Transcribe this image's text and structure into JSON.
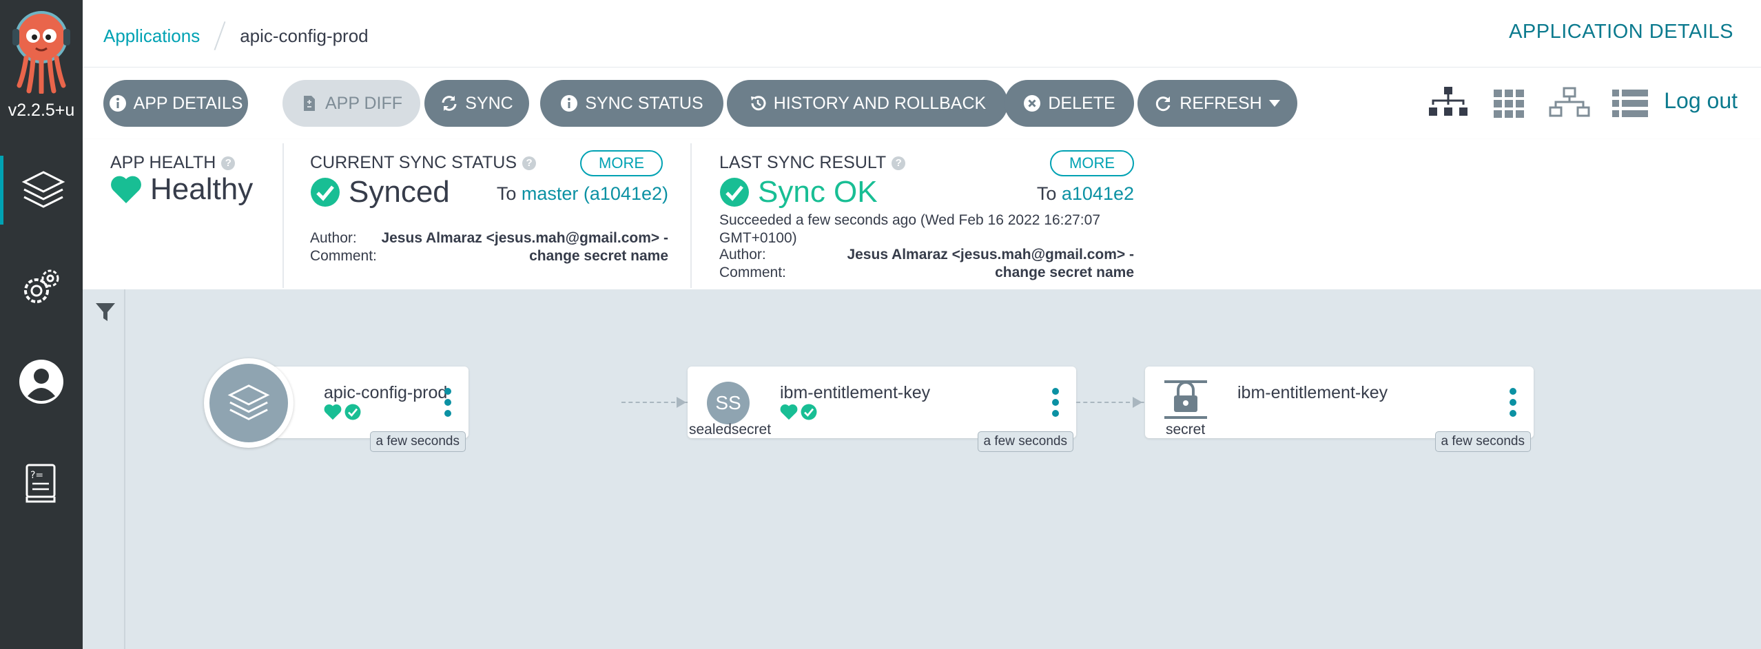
{
  "sidebar": {
    "version": "v2.2.5+u",
    "nav": [
      {
        "name": "applications",
        "icon": "layers-icon"
      },
      {
        "name": "settings",
        "icon": "gears-icon"
      },
      {
        "name": "user-info",
        "icon": "user-circle-icon"
      },
      {
        "name": "docs",
        "icon": "docs-icon"
      }
    ]
  },
  "header": {
    "breadcrumb_root": "Applications",
    "breadcrumb_current": "apic-config-prod",
    "page_heading": "APPLICATION DETAILS"
  },
  "toolbar": {
    "app_details": "APP DETAILS",
    "app_diff": "APP DIFF",
    "sync": "SYNC",
    "sync_status": "SYNC STATUS",
    "history": "HISTORY AND ROLLBACK",
    "delete": "DELETE",
    "refresh": "REFRESH",
    "logout": "Log out"
  },
  "status": {
    "app_health": {
      "title": "APP HEALTH",
      "value": "Healthy"
    },
    "current_sync": {
      "title": "CURRENT SYNC STATUS",
      "more": "MORE",
      "value": "Synced",
      "to_label": "To",
      "to_rev": "master (a1041e2)",
      "author_label": "Author:",
      "author_value": "Jesus Almaraz <jesus.mah@gmail.com> -",
      "comment_label": "Comment:",
      "comment_value": "change secret name"
    },
    "last_sync": {
      "title": "LAST SYNC RESULT",
      "more": "MORE",
      "value": "Sync OK",
      "to_label": "To",
      "to_rev": "a1041e2",
      "succeeded_line1": "Succeeded a few seconds ago (Wed Feb 16 2022 16:27:07",
      "succeeded_line2": "GMT+0100)",
      "author_label": "Author:",
      "author_value": "Jesus Almaraz <jesus.mah@gmail.com> -",
      "comment_label": "Comment:",
      "comment_value": "change secret name"
    }
  },
  "graph": {
    "nodes": [
      {
        "name": "apic-config-prod",
        "kind": "",
        "age": "a few seconds",
        "icon": "layers-icon"
      },
      {
        "name": "ibm-entitlement-key",
        "kind": "sealedsecret",
        "abbr": "SS",
        "age": "a few seconds"
      },
      {
        "name": "ibm-entitlement-key",
        "kind": "secret",
        "age": "a few seconds",
        "icon": "secret-lock-icon"
      }
    ]
  },
  "colors": {
    "accent": "#00a2b3",
    "healthy": "#18be94",
    "button": "#6d7f8b",
    "sidebar": "#2f3437"
  }
}
